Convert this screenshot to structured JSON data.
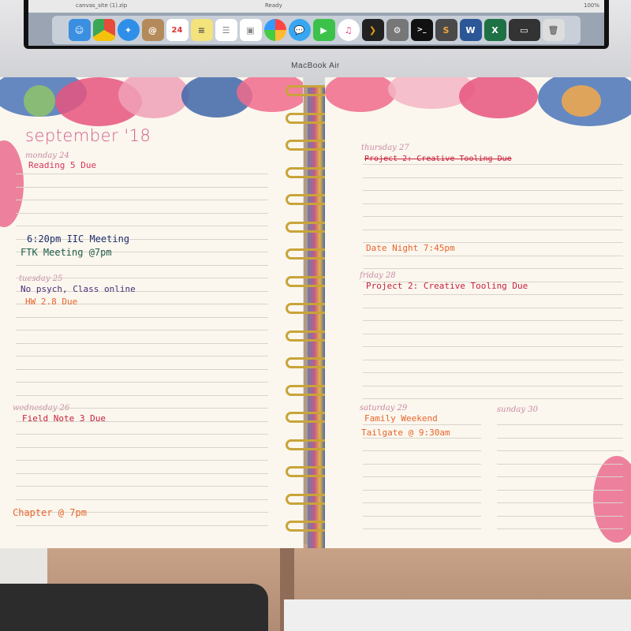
{
  "laptop": {
    "brand": "MacBook Air",
    "menubar_file": "canvas_site (1).zip",
    "menubar_status": "Ready",
    "zoom": "100%",
    "calendar_day": "24",
    "dock_icons": [
      "finder-icon",
      "chrome-icon",
      "safari-icon",
      "contacts-icon",
      "calendar-icon",
      "notes-icon",
      "reminders-icon",
      "photos-icon",
      "messages-icon",
      "facetime-icon",
      "itunes-icon",
      "plex-icon",
      "system-preferences-icon",
      "terminal-icon",
      "sublime-icon",
      "word-icon",
      "excel-icon",
      "folder-icon",
      "trash-icon"
    ]
  },
  "planner": {
    "month": "september '18",
    "days": [
      {
        "key": "mon",
        "label": "monday 24"
      },
      {
        "key": "tue",
        "label": "tuesday 25"
      },
      {
        "key": "wed",
        "label": "wednesday 26"
      },
      {
        "key": "thu",
        "label": "thursday 27"
      },
      {
        "key": "fri",
        "label": "friday 28"
      },
      {
        "key": "sat",
        "label": "saturday 29"
      },
      {
        "key": "sun",
        "label": "sunday 30"
      }
    ],
    "notes": {
      "mon_1": "Reading 5 Due",
      "mon_2": "6:20pm  IIC Meeting",
      "mon_3": "FTK Meeting @7pm",
      "tue_1": "No psych, Class online",
      "tue_2": "HW 2.8 Due",
      "wed_1": "Field Note 3 Due",
      "wed_2": "Chapter @ 7pm",
      "thu_1": "Project 2: Creative Tooling Due",
      "thu_2": "Date Night  7:45pm",
      "fri_1": "Project 2: Creative Tooling Due",
      "sat_1": "Family Weekend",
      "sat_2": "Tailgate @ 9:30am"
    }
  },
  "colors": {
    "month": "#d35b8e",
    "pink_ink": "#d8355e",
    "blue_ink": "#20306e",
    "green_ink": "#1f5c4a",
    "orange_ink": "#e8642b",
    "red_ink": "#c8203d",
    "purple_ink": "#4a2d7a"
  }
}
